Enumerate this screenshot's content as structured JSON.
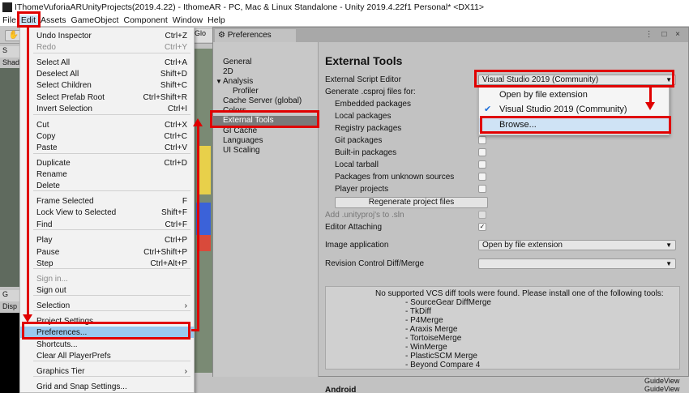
{
  "window": {
    "title": "IThomeVuforiaARUnityProjects(2019.4.22) - IthomeAR - PC, Mac & Linux Standalone - Unity 2019.4.22f1 Personal* <DX11>"
  },
  "menubar": [
    "File",
    "Edit",
    "Assets",
    "GameObject",
    "Component",
    "Window",
    "Help"
  ],
  "editor": {
    "scene_tab": "S",
    "shading": "Shad",
    "game_tab": "G",
    "display": "Disp",
    "glo_tab": "Glo",
    "bottom_items": [
      "GuideView",
      "GuideView"
    ]
  },
  "edit_menu": {
    "items": [
      {
        "label": "Undo Inspector",
        "shortcut": "Ctrl+Z"
      },
      {
        "label": "Redo",
        "shortcut": "Ctrl+Y",
        "disabled": true
      },
      {
        "label": "Select All",
        "shortcut": "Ctrl+A"
      },
      {
        "label": "Deselect All",
        "shortcut": "Shift+D"
      },
      {
        "label": "Select Children",
        "shortcut": "Shift+C"
      },
      {
        "label": "Select Prefab Root",
        "shortcut": "Ctrl+Shift+R"
      },
      {
        "label": "Invert Selection",
        "shortcut": "Ctrl+I"
      },
      {
        "label": "Cut",
        "shortcut": "Ctrl+X"
      },
      {
        "label": "Copy",
        "shortcut": "Ctrl+C"
      },
      {
        "label": "Paste",
        "shortcut": "Ctrl+V"
      },
      {
        "label": "Duplicate",
        "shortcut": "Ctrl+D"
      },
      {
        "label": "Rename",
        "shortcut": ""
      },
      {
        "label": "Delete",
        "shortcut": ""
      },
      {
        "label": "Frame Selected",
        "shortcut": "F"
      },
      {
        "label": "Lock View to Selected",
        "shortcut": "Shift+F"
      },
      {
        "label": "Find",
        "shortcut": "Ctrl+F"
      },
      {
        "label": "Play",
        "shortcut": "Ctrl+P"
      },
      {
        "label": "Pause",
        "shortcut": "Ctrl+Shift+P"
      },
      {
        "label": "Step",
        "shortcut": "Ctrl+Alt+P"
      },
      {
        "label": "Sign in...",
        "shortcut": "",
        "disabled": true
      },
      {
        "label": "Sign out",
        "shortcut": ""
      },
      {
        "label": "Selection",
        "shortcut": "›"
      },
      {
        "label": "Project Settings...",
        "shortcut": ""
      },
      {
        "label": "Preferences...",
        "shortcut": "",
        "highlighted": true
      },
      {
        "label": "Shortcuts...",
        "shortcut": ""
      },
      {
        "label": "Clear All PlayerPrefs",
        "shortcut": ""
      },
      {
        "label": "Graphics Tier",
        "shortcut": "›"
      },
      {
        "label": "Grid and Snap Settings...",
        "shortcut": ""
      }
    ]
  },
  "preferences": {
    "tab_title": "Preferences",
    "window_controls": "⋮ □ ×",
    "sidebar": [
      "General",
      "2D",
      "Analysis",
      "Profiler",
      "Cache Server (global)",
      "Colors",
      "External Tools",
      "GI Cache",
      "Languages",
      "UI Scaling"
    ],
    "selected_section": "External Tools",
    "heading": "External Tools",
    "external_script_editor_label": "External Script Editor",
    "external_script_editor_value": "Visual Studio 2019 (Community)",
    "generate_label": "Generate .csproj files for:",
    "packages": [
      {
        "label": "Embedded packages",
        "checked": false
      },
      {
        "label": "Local packages",
        "checked": false
      },
      {
        "label": "Registry packages",
        "checked": false
      },
      {
        "label": "Git packages",
        "checked": false
      },
      {
        "label": "Built-in packages",
        "checked": false
      },
      {
        "label": "Local tarball",
        "checked": false
      },
      {
        "label": "Packages from unknown sources",
        "checked": false
      },
      {
        "label": "Player projects",
        "checked": false
      }
    ],
    "regenerate_button": "Regenerate project files",
    "add_unityproj_label": "Add .unityproj's to .sln",
    "editor_attaching_label": "Editor Attaching",
    "editor_attaching_checked": true,
    "image_application_label": "Image application",
    "image_application_value": "Open by file extension",
    "revision_control_label": "Revision Control Diff/Merge",
    "revision_control_value": "",
    "vcs_message": "No supported VCS diff tools were found. Please install one of the following tools:",
    "vcs_tools": [
      "- SourceGear DiffMerge",
      "- TkDiff",
      "- P4Merge",
      "- Araxis Merge",
      "- TortoiseMerge",
      "- WinMerge",
      "- PlasticSCM Merge",
      "- Beyond Compare 4"
    ],
    "android_heading": "Android"
  },
  "editor_popup": {
    "options": [
      {
        "label": "Open by file extension",
        "checked": false
      },
      {
        "label": "Visual Studio 2019 (Community)",
        "checked": true
      },
      {
        "label": "Browse...",
        "checked": false,
        "hover": true
      }
    ]
  },
  "colors": {
    "highlight_red": "#e00000",
    "menu_highlight": "#99c9ef",
    "sidebar_selected": "#7a7a7a"
  }
}
